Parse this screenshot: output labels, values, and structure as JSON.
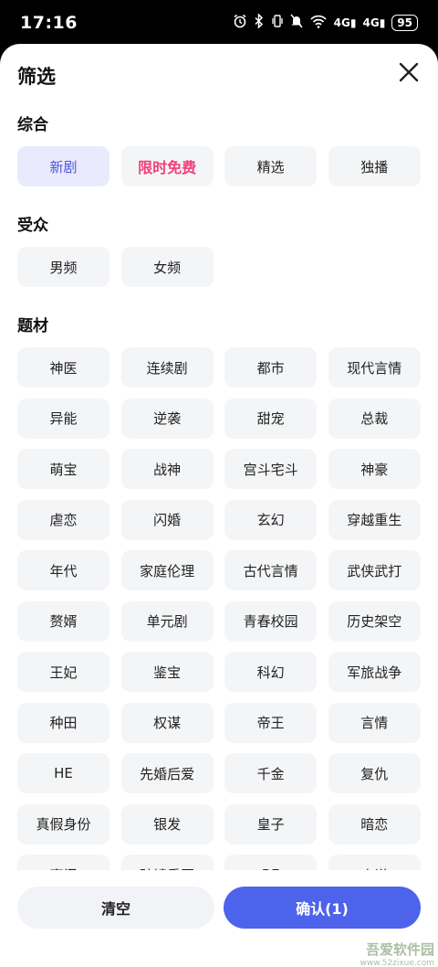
{
  "status_bar": {
    "time": "17:16",
    "icons": [
      "alarm-icon",
      "bluetooth-icon",
      "vibrate-icon",
      "mute-icon",
      "wifi-icon"
    ],
    "network_1": "4G",
    "network_2": "4G",
    "wifi_label": "6",
    "battery": "95"
  },
  "sheet": {
    "title": "筛选"
  },
  "sections": {
    "general": {
      "title": "综合",
      "chips": [
        "新剧",
        "限时免费",
        "精选",
        "独播"
      ]
    },
    "audience": {
      "title": "受众",
      "chips": [
        "男频",
        "女频"
      ]
    },
    "genre": {
      "title": "题材",
      "chips": [
        "神医",
        "连续剧",
        "都市",
        "现代言情",
        "异能",
        "逆袭",
        "甜宠",
        "总裁",
        "萌宝",
        "战神",
        "宫斗宅斗",
        "神豪",
        "虐恋",
        "闪婚",
        "玄幻",
        "穿越重生",
        "年代",
        "家庭伦理",
        "古代言情",
        "武侠武打",
        "赘婿",
        "单元剧",
        "青春校园",
        "历史架空",
        "王妃",
        "鉴宝",
        "科幻",
        "军旅战争",
        "种田",
        "权谋",
        "帝王",
        "言情",
        "HE",
        "先婚后爱",
        "千金",
        "复仇",
        "真假身份",
        "银发",
        "皇子",
        "暗恋",
        "豪门",
        "破镜重圆",
        "BE",
        "小说"
      ]
    }
  },
  "selected": {
    "general": "新剧"
  },
  "footer": {
    "clear_label": "清空",
    "confirm_label": "确认(1)"
  },
  "watermark": {
    "name": "吾爱软件园",
    "url": "www.52zixue.com"
  },
  "colors": {
    "accent": "#4d63ec",
    "selected_bg": "#e9eafc",
    "selected_text": "#4b57e0",
    "promo_text": "#f0407a",
    "chip_bg": "#f4f5f7"
  }
}
